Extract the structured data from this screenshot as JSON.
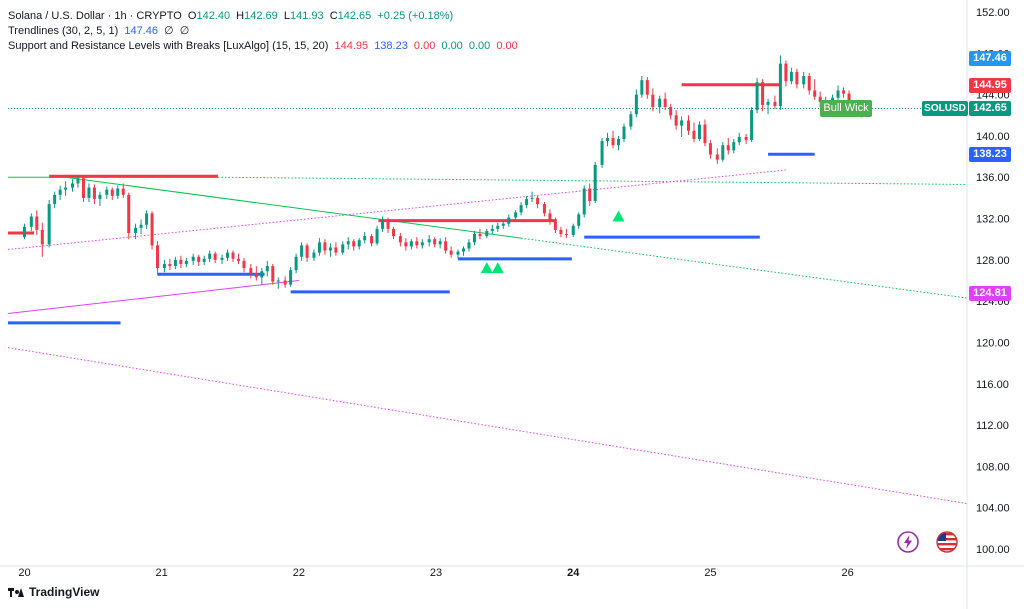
{
  "header": {
    "symbol": "Solana / U.S. Dollar · 1h · CRYPTO",
    "open_label": "O",
    "open": "142.40",
    "high_label": "H",
    "high": "142.69",
    "low_label": "L",
    "low": "141.93",
    "close_label": "C",
    "close": "142.65",
    "change": "+0.25 (+0.18%)",
    "indicator1_name": "Trendlines (30, 2, 5, 1)",
    "indicator1_value": "147.46",
    "indicator1_extra1": "∅",
    "indicator1_extra2": "∅",
    "indicator2_name": "Support and Resistance Levels with Breaks [LuxAlgo] (15, 15, 20)",
    "indicator2_v1": "144.95",
    "indicator2_v2": "138.23",
    "indicator2_v3": "0.00",
    "indicator2_v4": "0.00",
    "indicator2_v5": "0.00",
    "indicator2_v6": "0.00"
  },
  "price_tags": {
    "trend_upper": "147.46",
    "resistance": "144.95",
    "symbol": "SOLUSD",
    "last": "142.65",
    "support": "138.23",
    "trend_lower": "124.81"
  },
  "annotation": {
    "bull_wick": "Bull Wick"
  },
  "brand": {
    "name": "TradingView"
  },
  "colors": {
    "up": "#089981",
    "down": "#f23645",
    "resistance": "#f23645",
    "support": "#2962ff",
    "trendline": "#00c853",
    "trend_dotted": "#e040fb",
    "tag_blue": "#2196f3",
    "tag_magenta": "#e040fb"
  },
  "chart_data": {
    "type": "candlestick",
    "y_axis": {
      "min": 100,
      "max": 152,
      "ticks": [
        "152.00",
        "148.00",
        "144.00",
        "140.00",
        "136.00",
        "132.00",
        "128.00",
        "124.00",
        "120.00",
        "116.00",
        "112.00",
        "108.00",
        "104.00",
        "100.00"
      ]
    },
    "x_axis": {
      "min_day": 19.88,
      "max_day": 26.87,
      "ticks": [
        {
          "day": 20,
          "label": "20"
        },
        {
          "day": 21,
          "label": "21"
        },
        {
          "day": 22,
          "label": "22"
        },
        {
          "day": 23,
          "label": "23"
        },
        {
          "day": 24,
          "label": "24",
          "bold": true
        },
        {
          "day": 25,
          "label": "25"
        },
        {
          "day": 26,
          "label": "26"
        }
      ]
    },
    "candles": [
      [
        20.0,
        130.2,
        131.5,
        130.0,
        131.2
      ],
      [
        20.05,
        131.2,
        132.5,
        130.8,
        132.2
      ],
      [
        20.09,
        132.2,
        132.8,
        130.4,
        130.9
      ],
      [
        20.13,
        130.9,
        131.6,
        128.3,
        129.5
      ],
      [
        20.18,
        129.5,
        133.8,
        129.2,
        133.4
      ],
      [
        20.22,
        133.4,
        134.6,
        133.0,
        134.3
      ],
      [
        20.26,
        134.3,
        135.2,
        133.8,
        134.8
      ],
      [
        20.3,
        134.8,
        135.6,
        134.2,
        135.0
      ],
      [
        20.35,
        135.0,
        135.8,
        134.6,
        135.4
      ],
      [
        20.39,
        135.4,
        136.2,
        135.0,
        135.9
      ],
      [
        20.43,
        135.9,
        136.1,
        133.6,
        134.0
      ],
      [
        20.47,
        134.0,
        135.4,
        133.6,
        135.0
      ],
      [
        20.51,
        135.0,
        135.3,
        133.4,
        133.9
      ],
      [
        20.55,
        133.9,
        134.6,
        133.2,
        134.3
      ],
      [
        20.6,
        134.3,
        135.1,
        133.9,
        134.8
      ],
      [
        20.64,
        134.8,
        135.0,
        133.8,
        134.2
      ],
      [
        20.68,
        134.2,
        135.2,
        133.9,
        134.9
      ],
      [
        20.72,
        134.9,
        135.4,
        134.0,
        134.3
      ],
      [
        20.76,
        134.3,
        134.5,
        130.0,
        130.6
      ],
      [
        20.81,
        130.6,
        131.5,
        130.0,
        131.1
      ],
      [
        20.85,
        131.1,
        131.9,
        130.5,
        131.4
      ],
      [
        20.89,
        131.4,
        132.8,
        131.0,
        132.5
      ],
      [
        20.93,
        132.5,
        132.7,
        129.0,
        129.4
      ],
      [
        20.97,
        129.4,
        129.8,
        126.5,
        127.2
      ],
      [
        21.02,
        127.2,
        128.0,
        126.8,
        127.6
      ],
      [
        21.06,
        127.6,
        128.1,
        127.0,
        127.4
      ],
      [
        21.1,
        127.4,
        128.3,
        127.1,
        128.0
      ],
      [
        21.14,
        128.0,
        128.4,
        127.2,
        127.6
      ],
      [
        21.18,
        127.6,
        128.2,
        127.3,
        127.9
      ],
      [
        21.23,
        127.9,
        128.6,
        127.5,
        128.3
      ],
      [
        21.27,
        128.3,
        128.5,
        127.4,
        127.8
      ],
      [
        21.31,
        127.8,
        128.4,
        127.5,
        128.1
      ],
      [
        21.35,
        128.1,
        128.9,
        127.8,
        128.6
      ],
      [
        21.39,
        128.6,
        128.8,
        127.7,
        128.0
      ],
      [
        21.44,
        128.0,
        128.5,
        127.6,
        128.2
      ],
      [
        21.48,
        128.2,
        129.0,
        127.9,
        128.7
      ],
      [
        21.52,
        128.7,
        128.9,
        127.8,
        128.1
      ],
      [
        21.56,
        128.1,
        128.6,
        127.6,
        127.9
      ],
      [
        21.6,
        127.9,
        128.2,
        126.8,
        127.2
      ],
      [
        21.65,
        127.2,
        127.6,
        126.2,
        126.7
      ],
      [
        21.69,
        126.7,
        127.4,
        126.0,
        126.3
      ],
      [
        21.73,
        126.3,
        127.2,
        125.6,
        126.9
      ],
      [
        21.77,
        126.9,
        127.9,
        126.4,
        127.4
      ],
      [
        21.81,
        127.4,
        127.6,
        125.6,
        125.9
      ],
      [
        21.85,
        125.9,
        126.3,
        125.2,
        126.0
      ],
      [
        21.9,
        126.0,
        126.4,
        125.3,
        125.6
      ],
      [
        21.94,
        125.6,
        127.3,
        125.4,
        127.0
      ],
      [
        21.98,
        127.0,
        128.6,
        126.7,
        128.3
      ],
      [
        22.02,
        128.3,
        129.7,
        127.9,
        129.4
      ],
      [
        22.06,
        129.4,
        129.6,
        127.8,
        128.2
      ],
      [
        22.11,
        128.2,
        129.0,
        127.9,
        128.7
      ],
      [
        22.15,
        128.7,
        130.1,
        128.4,
        129.7
      ],
      [
        22.19,
        129.7,
        130.0,
        128.5,
        128.9
      ],
      [
        22.23,
        128.9,
        129.6,
        128.3,
        129.2
      ],
      [
        22.27,
        129.2,
        129.7,
        128.4,
        128.7
      ],
      [
        22.32,
        128.7,
        129.8,
        128.5,
        129.5
      ],
      [
        22.36,
        129.5,
        130.2,
        129.0,
        129.8
      ],
      [
        22.4,
        129.8,
        130.0,
        128.9,
        129.3
      ],
      [
        22.44,
        129.3,
        130.1,
        129.0,
        129.9
      ],
      [
        22.48,
        129.9,
        130.7,
        129.6,
        130.3
      ],
      [
        22.53,
        130.3,
        130.5,
        129.3,
        129.6
      ],
      [
        22.57,
        129.6,
        131.3,
        129.4,
        131.0
      ],
      [
        22.61,
        131.0,
        132.2,
        130.7,
        131.9
      ],
      [
        22.65,
        131.9,
        132.1,
        130.6,
        131.0
      ],
      [
        22.69,
        131.0,
        131.2,
        130.0,
        130.3
      ],
      [
        22.74,
        130.3,
        130.6,
        129.3,
        129.7
      ],
      [
        22.78,
        129.7,
        130.1,
        128.9,
        129.3
      ],
      [
        22.82,
        129.3,
        130.0,
        129.0,
        129.8
      ],
      [
        22.86,
        129.8,
        130.2,
        129.1,
        129.4
      ],
      [
        22.9,
        129.4,
        130.0,
        129.1,
        129.7
      ],
      [
        22.95,
        129.7,
        130.4,
        129.3,
        130.0
      ],
      [
        22.99,
        130.0,
        130.2,
        129.2,
        129.5
      ],
      [
        23.03,
        129.5,
        130.1,
        129.1,
        129.8
      ],
      [
        23.07,
        129.8,
        130.2,
        128.6,
        128.9
      ],
      [
        23.11,
        128.9,
        129.3,
        128.2,
        128.5
      ],
      [
        23.16,
        128.5,
        129.0,
        128.1,
        128.8
      ],
      [
        23.2,
        128.8,
        129.3,
        128.4,
        129.1
      ],
      [
        23.24,
        129.1,
        130.0,
        128.8,
        129.7
      ],
      [
        23.28,
        129.7,
        130.8,
        129.4,
        130.5
      ],
      [
        23.32,
        130.5,
        131.0,
        130.0,
        130.3
      ],
      [
        23.37,
        130.3,
        131.0,
        130.1,
        130.8
      ],
      [
        23.41,
        130.8,
        131.4,
        130.5,
        131.0
      ],
      [
        23.45,
        131.0,
        131.6,
        130.7,
        131.3
      ],
      [
        23.49,
        131.3,
        131.8,
        131.0,
        131.5
      ],
      [
        23.53,
        131.5,
        132.4,
        131.2,
        132.1
      ],
      [
        23.58,
        132.1,
        132.8,
        131.9,
        132.6
      ],
      [
        23.62,
        132.6,
        133.6,
        132.3,
        133.3
      ],
      [
        23.66,
        133.3,
        134.2,
        133.0,
        133.9
      ],
      [
        23.7,
        133.9,
        134.6,
        133.6,
        134.0
      ],
      [
        23.74,
        134.0,
        134.2,
        133.0,
        133.4
      ],
      [
        23.79,
        133.4,
        133.6,
        132.2,
        132.5
      ],
      [
        23.83,
        132.5,
        132.9,
        131.4,
        131.7
      ],
      [
        23.87,
        131.7,
        132.1,
        130.6,
        130.9
      ],
      [
        23.91,
        130.9,
        131.2,
        130.2,
        130.5
      ],
      [
        23.95,
        130.5,
        131.0,
        130.1,
        130.4
      ],
      [
        24.0,
        130.4,
        131.5,
        130.2,
        131.3
      ],
      [
        24.04,
        131.3,
        132.6,
        131.0,
        132.4
      ],
      [
        24.08,
        132.4,
        135.2,
        132.1,
        134.9
      ],
      [
        24.12,
        134.9,
        135.4,
        133.2,
        133.7
      ],
      [
        24.16,
        133.7,
        137.5,
        133.5,
        137.2
      ],
      [
        24.21,
        137.2,
        139.8,
        136.9,
        139.5
      ],
      [
        24.25,
        139.5,
        140.3,
        139.0,
        139.8
      ],
      [
        24.29,
        139.8,
        140.5,
        138.8,
        139.1
      ],
      [
        24.33,
        139.1,
        140.0,
        138.6,
        139.7
      ],
      [
        24.37,
        139.7,
        141.2,
        139.4,
        140.9
      ],
      [
        24.42,
        140.9,
        142.4,
        140.6,
        142.1
      ],
      [
        24.46,
        142.1,
        144.5,
        141.8,
        144.0
      ],
      [
        24.5,
        144.0,
        145.8,
        143.7,
        145.4
      ],
      [
        24.54,
        145.4,
        145.7,
        143.6,
        144.0
      ],
      [
        24.58,
        144.0,
        144.6,
        142.4,
        142.8
      ],
      [
        24.63,
        142.8,
        143.9,
        142.2,
        143.6
      ],
      [
        24.67,
        143.6,
        144.2,
        142.5,
        142.8
      ],
      [
        24.71,
        142.8,
        143.1,
        141.6,
        142.0
      ],
      [
        24.75,
        142.0,
        142.5,
        140.6,
        141.0
      ],
      [
        24.79,
        141.0,
        141.9,
        139.9,
        141.5
      ],
      [
        24.84,
        141.5,
        142.0,
        140.1,
        140.5
      ],
      [
        24.88,
        140.5,
        141.3,
        139.4,
        139.7
      ],
      [
        24.92,
        139.7,
        141.4,
        139.5,
        141.1
      ],
      [
        24.96,
        141.1,
        141.6,
        139.0,
        139.3
      ],
      [
        25.0,
        139.3,
        139.6,
        137.8,
        138.2
      ],
      [
        25.05,
        138.2,
        138.8,
        137.3,
        137.7
      ],
      [
        25.09,
        137.7,
        139.4,
        137.5,
        139.1
      ],
      [
        25.13,
        139.1,
        139.8,
        138.2,
        138.6
      ],
      [
        25.17,
        138.6,
        139.7,
        138.3,
        139.4
      ],
      [
        25.21,
        139.4,
        140.3,
        139.1,
        139.9
      ],
      [
        25.26,
        139.9,
        140.2,
        139.2,
        139.6
      ],
      [
        25.3,
        139.6,
        142.8,
        139.4,
        142.5
      ],
      [
        25.34,
        142.5,
        145.6,
        142.2,
        145.2
      ],
      [
        25.38,
        145.2,
        145.5,
        142.4,
        143.0
      ],
      [
        25.42,
        143.0,
        143.6,
        142.1,
        143.3
      ],
      [
        25.47,
        143.3,
        143.9,
        142.6,
        142.9
      ],
      [
        25.51,
        142.9,
        147.8,
        142.5,
        147.0
      ],
      [
        25.55,
        147.0,
        147.3,
        144.8,
        145.3
      ],
      [
        25.59,
        145.3,
        146.6,
        145.0,
        146.2
      ],
      [
        25.63,
        146.2,
        146.5,
        144.6,
        145.0
      ],
      [
        25.68,
        145.0,
        146.2,
        144.6,
        145.8
      ],
      [
        25.72,
        145.8,
        146.1,
        144.0,
        144.4
      ],
      [
        25.76,
        144.4,
        145.5,
        143.5,
        143.8
      ],
      [
        25.8,
        143.8,
        144.3,
        142.8,
        143.3
      ],
      [
        25.84,
        143.3,
        143.8,
        142.4,
        142.7
      ],
      [
        25.89,
        142.7,
        144.0,
        142.5,
        143.7
      ],
      [
        25.93,
        143.7,
        144.9,
        143.4,
        144.4
      ],
      [
        25.97,
        144.4,
        144.7,
        143.7,
        144.1
      ],
      [
        26.01,
        144.1,
        144.4,
        142.8,
        143.2
      ],
      [
        26.05,
        143.2,
        143.4,
        141.9,
        142.2
      ],
      [
        26.1,
        142.2,
        142.6,
        141.8,
        142.3
      ],
      [
        26.14,
        142.4,
        142.69,
        141.93,
        142.65
      ]
    ],
    "resistance_levels": [
      {
        "from": 19.88,
        "to": 20.07,
        "price": 130.6
      },
      {
        "from": 20.18,
        "to": 21.41,
        "price": 136.1
      },
      {
        "from": 22.58,
        "to": 23.88,
        "price": 131.8
      },
      {
        "from": 24.79,
        "to": 25.51,
        "price": 144.95
      }
    ],
    "support_levels": [
      {
        "from": 19.88,
        "to": 20.7,
        "price": 121.9
      },
      {
        "from": 20.97,
        "to": 21.75,
        "price": 126.6
      },
      {
        "from": 21.94,
        "to": 23.1,
        "price": 124.9
      },
      {
        "from": 23.16,
        "to": 23.99,
        "price": 128.1
      },
      {
        "from": 24.08,
        "to": 25.36,
        "price": 130.2
      },
      {
        "from": 25.42,
        "to": 25.76,
        "price": 138.23
      }
    ],
    "trendlines": [
      {
        "style": "solid",
        "color": "green",
        "x1": 19.88,
        "y1": 136.0,
        "x2": 21.41,
        "y2": 136.0
      },
      {
        "style": "solid",
        "color": "green",
        "x1": 20.3,
        "y1": 136.0,
        "x2": 23.62,
        "y2": 130.1
      },
      {
        "style": "dotted",
        "color": "green",
        "x1": 23.62,
        "y1": 130.1,
        "x2": 26.87,
        "y2": 124.3
      },
      {
        "style": "dotted",
        "color": "green",
        "x1": 21.41,
        "y1": 136.0,
        "x2": 26.87,
        "y2": 135.3
      },
      {
        "style": "solid",
        "color": "magenta",
        "x1": 19.88,
        "y1": 122.8,
        "x2": 22.0,
        "y2": 126.0
      },
      {
        "style": "dotted",
        "color": "magenta",
        "x1": 19.88,
        "y1": 129.0,
        "x2": 25.55,
        "y2": 136.7
      },
      {
        "style": "dotted",
        "color": "magenta",
        "x1": 19.88,
        "y1": 119.5,
        "x2": 26.87,
        "y2": 104.4
      }
    ],
    "break_markers": [
      {
        "day": 23.37,
        "price": 127.2
      },
      {
        "day": 23.45,
        "price": 127.2
      },
      {
        "day": 24.33,
        "price": 132.2
      }
    ]
  }
}
